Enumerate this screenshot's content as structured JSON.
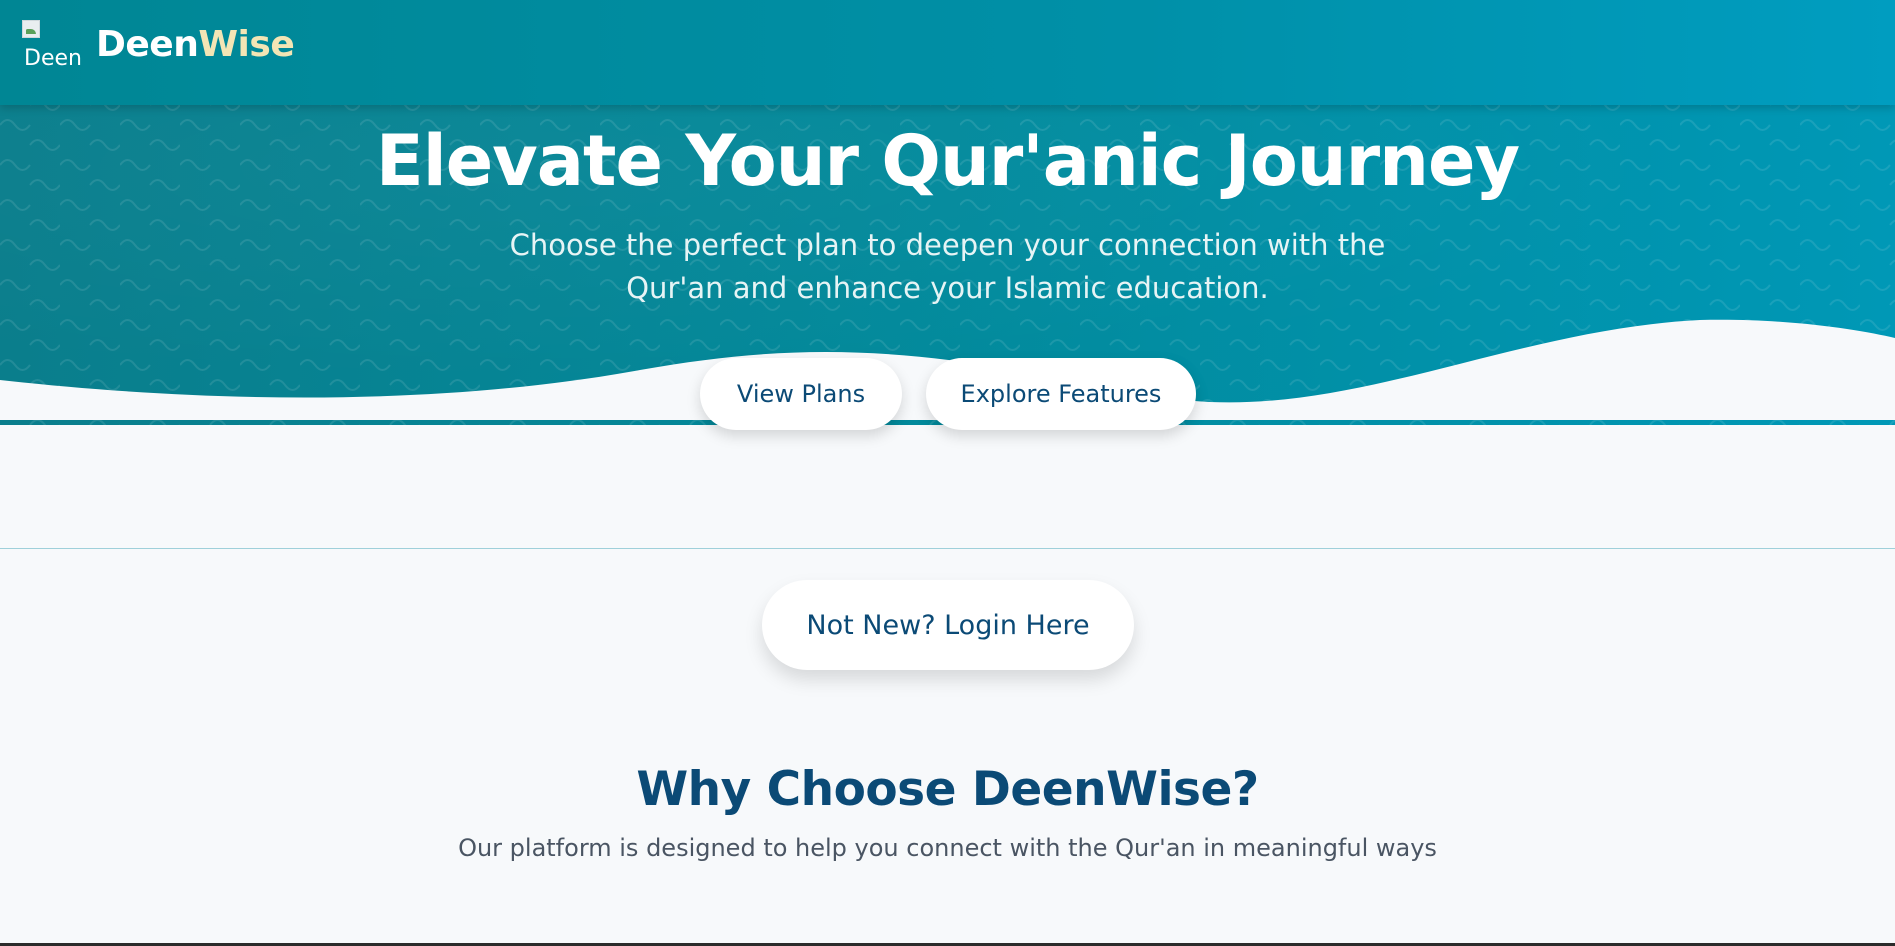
{
  "header": {
    "logo_alt": "Deen",
    "brand_part1": "Deen",
    "brand_part2": "Wise"
  },
  "hero": {
    "title": "Elevate Your Qur'anic Journey",
    "subtitle_line1": "Choose the perfect plan to deepen your connection with the",
    "subtitle_line2": "Qur'an and enhance your Islamic education.",
    "buttons": {
      "view_plans": "View Plans",
      "explore_features": "Explore Features"
    }
  },
  "login": {
    "label": "Not New? Login Here"
  },
  "why": {
    "title": "Why Choose DeenWise?",
    "subtitle": "Our platform is designed to help you connect with the Qur'an in meaningful ways"
  },
  "colors": {
    "header_start": "#008694",
    "header_end": "#009dc0",
    "brand_accent": "#f3e5b5",
    "primary_text": "#0b4a76",
    "page_bg": "#f7f9fb"
  }
}
